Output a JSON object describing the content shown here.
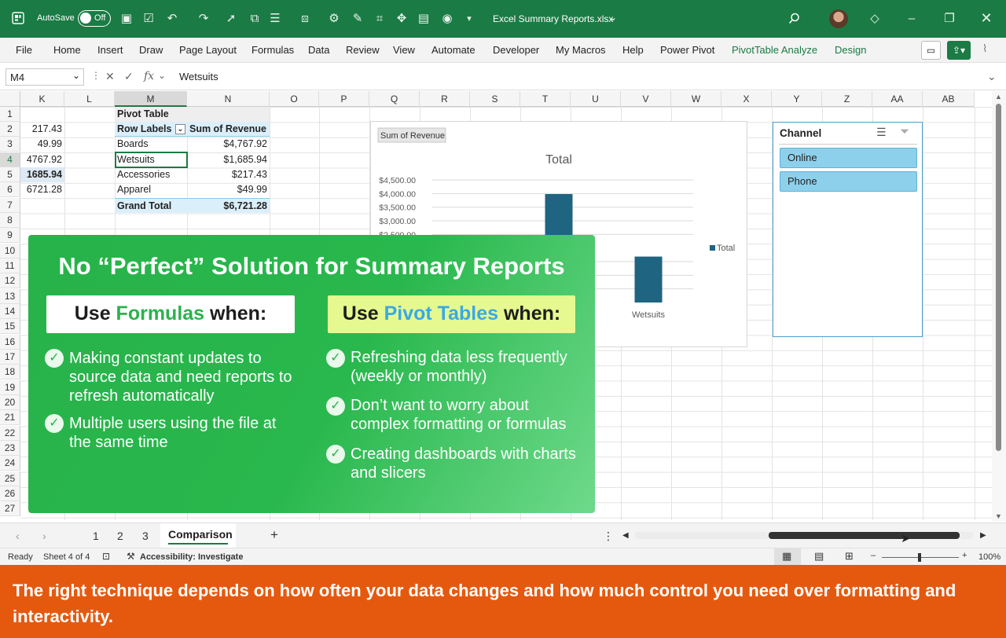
{
  "titlebar": {
    "autosave_label": "AutoSave",
    "autosave_state": "Off",
    "file_name": "Excel Summary Reports.xlsx",
    "bg_color": "#1b7b44"
  },
  "ribbon": {
    "tabs": [
      "File",
      "Home",
      "Insert",
      "Draw",
      "Page Layout",
      "Formulas",
      "Data",
      "Review",
      "View",
      "Automate",
      "Developer",
      "My Macros",
      "Help",
      "Power Pivot",
      "PivotTable Analyze",
      "Design"
    ]
  },
  "formula_bar": {
    "name_box": "M4",
    "fx_label": "fx",
    "content": "Wetsuits"
  },
  "columns": [
    "K",
    "L",
    "M",
    "N",
    "O",
    "P",
    "Q",
    "R",
    "S",
    "T",
    "U",
    "V",
    "W",
    "X",
    "Y",
    "Z",
    "AA",
    "AB"
  ],
  "rows": [
    "1",
    "2",
    "3",
    "4",
    "5",
    "6",
    "7",
    "8",
    "9",
    "10",
    "11",
    "12",
    "13",
    "14",
    "15",
    "16",
    "17",
    "18",
    "19",
    "20",
    "21",
    "22",
    "23",
    "24",
    "25",
    "26",
    "27"
  ],
  "col_k_values": [
    "217.43",
    "49.99",
    "4767.92",
    "1685.94",
    "6721.28"
  ],
  "pivot": {
    "title": "Pivot Table",
    "row_labels_header": "Row Labels",
    "value_header": "Sum of Revenue",
    "rows": [
      {
        "label": "Boards",
        "value": "$4,767.92"
      },
      {
        "label": "Wetsuits",
        "value": "$1,685.94"
      },
      {
        "label": "Accessories",
        "value": "$217.43"
      },
      {
        "label": "Apparel",
        "value": "$49.99"
      }
    ],
    "grand_total_label": "Grand Total",
    "grand_total_value": "$6,721.28"
  },
  "chart": {
    "field_button": "Sum of Revenue",
    "title": "Total",
    "y_ticks": [
      "$4,500.00",
      "$4,000.00",
      "$3,500.00",
      "$3,000.00",
      "$2,500.00"
    ],
    "legend": "Total",
    "visible_category": "Wetsuits"
  },
  "chart_data": {
    "type": "bar",
    "title": "Total",
    "categories": [
      "Boards",
      "Wetsuits"
    ],
    "values": [
      4767.92,
      1685.94
    ],
    "ylim": [
      0,
      4500
    ],
    "series": [
      {
        "name": "Total",
        "values": [
          4767.92,
          1685.94
        ]
      }
    ],
    "legend": "right",
    "color": "#1f6481"
  },
  "slicer": {
    "title": "Channel",
    "items": [
      "Online",
      "Phone"
    ]
  },
  "overlay": {
    "title": "No “Perfect” Solution for Summary Reports",
    "formulas": {
      "pre": "Use ",
      "key": "Formulas",
      "post": " when:",
      "points": [
        "Making constant updates to source data and need reports to refresh automatically",
        "Multiple users using the file at the same time"
      ]
    },
    "pivots": {
      "pre": "Use ",
      "key": "Pivot Tables",
      "post": " when:",
      "points": [
        "Refreshing data less frequently (weekly or monthly)",
        "Don’t want to worry about complex formatting or formulas",
        "Creating dashboards with charts and slicers"
      ]
    }
  },
  "sheets": [
    "1",
    "2",
    "3",
    "Comparison"
  ],
  "status": {
    "ready": "Ready",
    "sheet_info": "Sheet 4 of 4",
    "accessibility": "Accessibility: Investigate",
    "zoom": "100%"
  },
  "banner": "The right technique depends on how often your data changes and how much control you need over formatting and interactivity."
}
